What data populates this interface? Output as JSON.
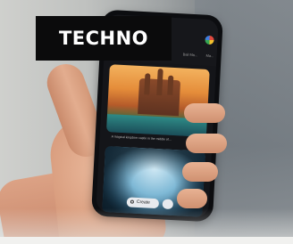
{
  "label": {
    "text": "TECHNO"
  },
  "phone": {
    "status_left": "Bali Ma...",
    "status_right": "Ma...",
    "caption": "A magical kingdom castle in the middle of...",
    "create_button": "Create",
    "image_top_desc": "castle",
    "image_bottom_desc": "ice cave"
  },
  "colors": {
    "label_bg": "#0b0b0c",
    "label_fg": "#ffffff",
    "phone_body": "#0c0d10"
  }
}
